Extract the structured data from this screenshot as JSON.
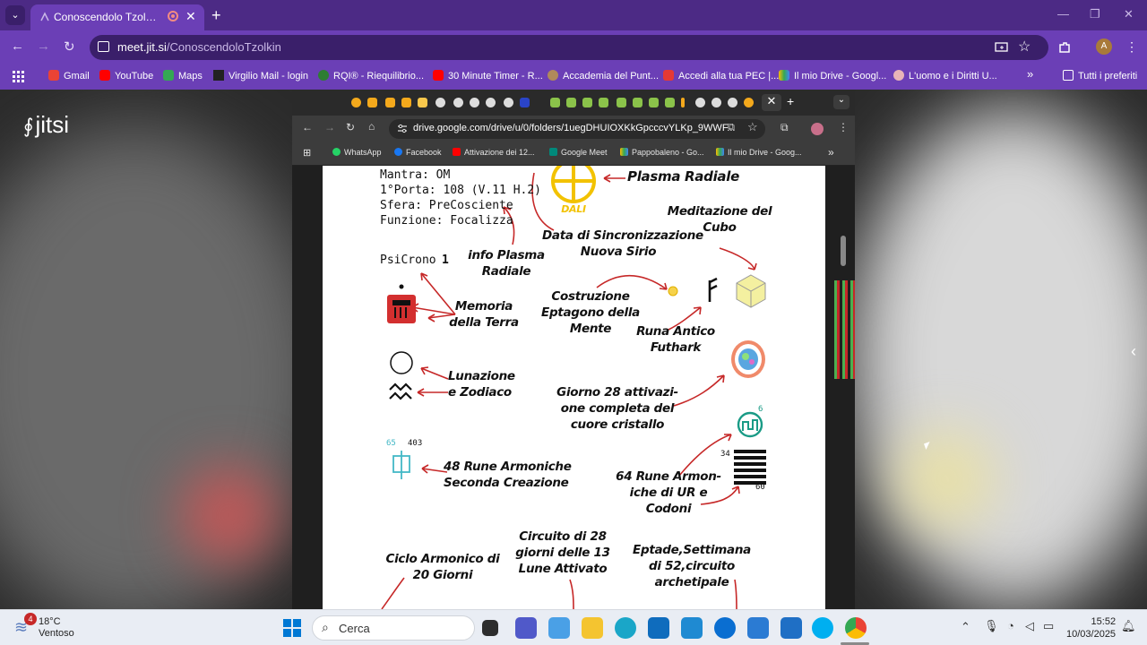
{
  "browser": {
    "tab_title": "Conoscendolo Tzolkin | Jitsi",
    "url_host": "meet.jit.si",
    "url_path": "/ConoscendoloTzolkin",
    "bookmarks": [
      "Gmail",
      "YouTube",
      "Maps",
      "Virgilio Mail - login",
      "RQI® - Riequilibrio...",
      "30 Minute Timer - R...",
      "Accademia del Punt...",
      "Accedi alla tua PEC |...",
      "Il mio Drive - Googl...",
      "L'uomo e i Diritti U...",
      "Tutti i preferiti"
    ],
    "new_tab": "+",
    "close": "✕",
    "more": "»"
  },
  "jitsi": {
    "logo": "jitsi"
  },
  "shared": {
    "url": "drive.google.com/drive/u/0/folders/1uegDHUIOXKkGpcccvYLKp_9WWF...",
    "bookmarks": [
      "WhatsApp",
      "Facebook",
      "Attivazione dei 12...",
      "Google Meet",
      "Pappobaleno - Go...",
      "Il mio Drive - Goog..."
    ],
    "more": "»"
  },
  "doc": {
    "mantra": "Mantra: OM",
    "porta": "1°Porta: 108 (V.11 H.2)",
    "sfera": "Sfera: PreCosciente",
    "funzione": "Funzione: Focalizza",
    "dali": "DALI",
    "plasma": "Plasma Radiale",
    "data_sync": "Data di Sincronizzazione\nNuova Sirio",
    "meditazione": "Meditazione del\nCubo",
    "info_plasma": "info Plasma\nRadiale",
    "psicrono": "PsiCrono",
    "psicrono_num": "1",
    "memoria": "Memoria\ndella Terra",
    "costruzione": "Costruzione\nEptagono della\nMente",
    "runa": "Runa Antico\nFuthark",
    "lunazione": "Lunazione\ne Zodiaco",
    "giorno28": "Giorno 28 attivazi-\none completa del\ncuore cristallo",
    "n6": "6",
    "n65": "65",
    "n403": "403",
    "rune48": "48 Rune Armoniche\nSeconda Creazione",
    "n34": "34",
    "n60": "60",
    "rune64": "64 Rune Armon-\niche di UR e\nCodoni",
    "circuito": "Circuito di 28\ngiorni delle 13\nLune Attivato",
    "ciclo": "Ciclo Armonico di\n20 Giorni",
    "eptade": "Eptade,Settimana\ndi 52,circuito\narchetipale"
  },
  "taskbar": {
    "weather_temp": "18°C",
    "weather_desc": "Ventoso",
    "weather_badge": "4",
    "search": "Cerca",
    "time": "15:52",
    "date": "10/03/2025"
  }
}
